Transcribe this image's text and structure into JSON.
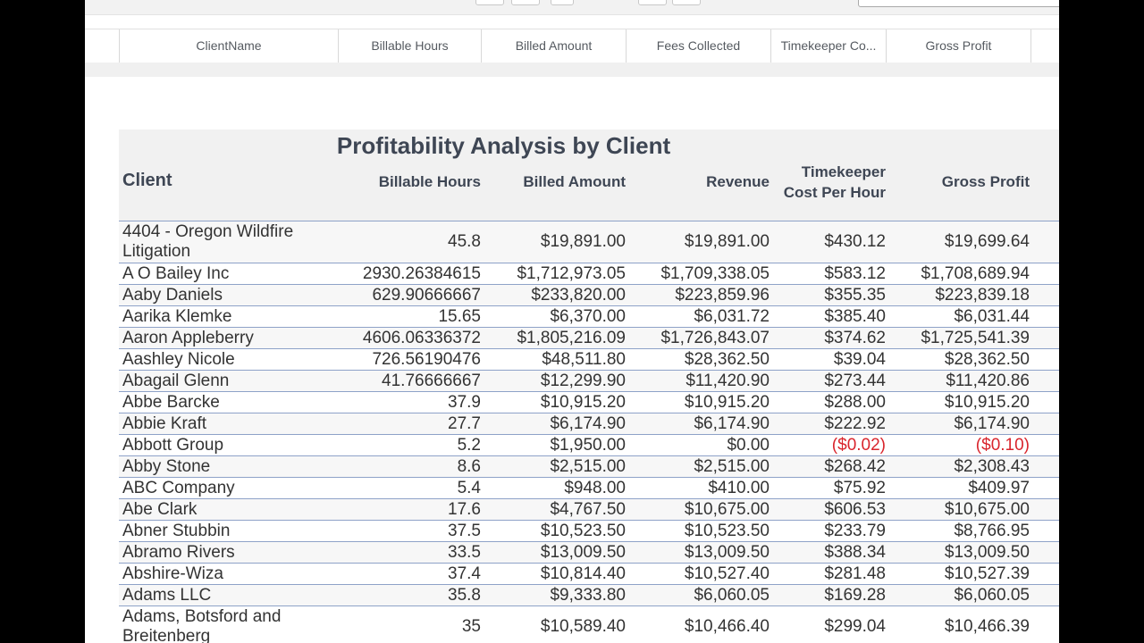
{
  "grid_header": {
    "columns": [
      "ClientName",
      "Billable Hours",
      "Billed Amount",
      "Fees Collected",
      "Timekeeper Co...",
      "Gross Profit"
    ]
  },
  "report": {
    "title": "Profitability Analysis by Client",
    "columns": {
      "client": "Client",
      "billable_hours": "Billable Hours",
      "billed_amount": "Billed Amount",
      "revenue": "Revenue",
      "timekeeper_cost_line1": "Timekeeper",
      "timekeeper_cost_line2": "Cost Per Hour",
      "gross_profit": "Gross Profit"
    },
    "rows": [
      {
        "client": "4404 - Oregon Wildfire Litigation",
        "hours": "45.8",
        "billed": "$19,891.00",
        "revenue": "$19,891.00",
        "cost": "$430.12",
        "profit": "$19,699.64"
      },
      {
        "client": "A O Bailey Inc",
        "hours": "2930.26384615",
        "billed": "$1,712,973.05",
        "revenue": "$1,709,338.05",
        "cost": "$583.12",
        "profit": "$1,708,689.94"
      },
      {
        "client": "Aaby Daniels",
        "hours": "629.90666667",
        "billed": "$233,820.00",
        "revenue": "$223,859.96",
        "cost": "$355.35",
        "profit": "$223,839.18"
      },
      {
        "client": "Aarika Klemke",
        "hours": "15.65",
        "billed": "$6,370.00",
        "revenue": "$6,031.72",
        "cost": "$385.40",
        "profit": "$6,031.44"
      },
      {
        "client": "Aaron Appleberry",
        "hours": "4606.06336372",
        "billed": "$1,805,216.09",
        "revenue": "$1,726,843.07",
        "cost": "$374.62",
        "profit": "$1,725,541.39"
      },
      {
        "client": "Aashley Nicole",
        "hours": "726.56190476",
        "billed": "$48,511.80",
        "revenue": "$28,362.50",
        "cost": "$39.04",
        "profit": "$28,362.50"
      },
      {
        "client": "Abagail Glenn",
        "hours": "41.76666667",
        "billed": "$12,299.90",
        "revenue": "$11,420.90",
        "cost": "$273.44",
        "profit": "$11,420.86"
      },
      {
        "client": "Abbe Barcke",
        "hours": "37.9",
        "billed": "$10,915.20",
        "revenue": "$10,915.20",
        "cost": "$288.00",
        "profit": "$10,915.20"
      },
      {
        "client": "Abbie Kraft",
        "hours": "27.7",
        "billed": "$6,174.90",
        "revenue": "$6,174.90",
        "cost": "$222.92",
        "profit": "$6,174.90"
      },
      {
        "client": "Abbott Group",
        "hours": "5.2",
        "billed": "$1,950.00",
        "revenue": "$0.00",
        "cost": "($0.02)",
        "profit": "($0.10)"
      },
      {
        "client": "Abby Stone",
        "hours": "8.6",
        "billed": "$2,515.00",
        "revenue": "$2,515.00",
        "cost": "$268.42",
        "profit": "$2,308.43"
      },
      {
        "client": "ABC Company",
        "hours": "5.4",
        "billed": "$948.00",
        "revenue": "$410.00",
        "cost": "$75.92",
        "profit": "$409.97"
      },
      {
        "client": "Abe Clark",
        "hours": "17.6",
        "billed": "$4,767.50",
        "revenue": "$10,675.00",
        "cost": "$606.53",
        "profit": "$10,675.00"
      },
      {
        "client": "Abner Stubbin",
        "hours": "37.5",
        "billed": "$10,523.50",
        "revenue": "$10,523.50",
        "cost": "$233.79",
        "profit": "$8,766.95"
      },
      {
        "client": "Abramo Rivers",
        "hours": "33.5",
        "billed": "$13,009.50",
        "revenue": "$13,009.50",
        "cost": "$388.34",
        "profit": "$13,009.50"
      },
      {
        "client": "Abshire-Wiza",
        "hours": "37.4",
        "billed": "$10,814.40",
        "revenue": "$10,527.40",
        "cost": "$281.48",
        "profit": "$10,527.39"
      },
      {
        "client": "Adams LLC",
        "hours": "35.8",
        "billed": "$9,333.80",
        "revenue": "$6,060.05",
        "cost": "$169.28",
        "profit": "$6,060.05"
      },
      {
        "client": "Adams, Botsford and Breitenberg",
        "hours": "35",
        "billed": "$10,589.40",
        "revenue": "$10,466.40",
        "cost": "$299.04",
        "profit": "$10,466.39"
      }
    ]
  },
  "colors": {
    "negative": "#d9252d",
    "row_divider": "#8ea2c8",
    "header_text": "#3e4654"
  }
}
